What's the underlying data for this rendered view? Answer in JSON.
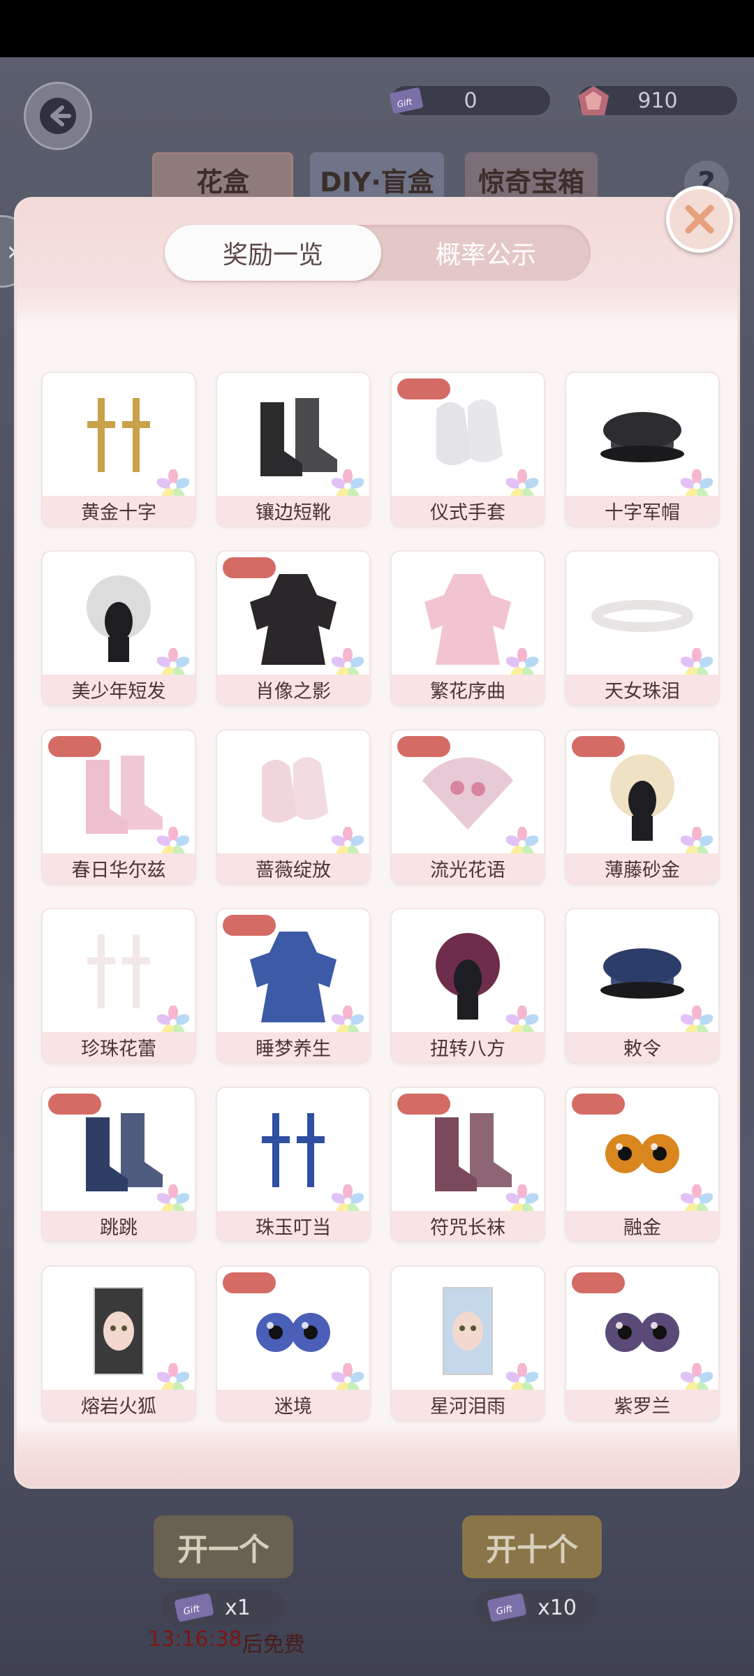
{
  "header": {
    "currency_ticket": {
      "value": "0",
      "icon": "ticket-icon"
    },
    "currency_gem": {
      "value": "910",
      "icon": "gem-icon"
    },
    "tabs": [
      {
        "label": "花盒"
      },
      {
        "label": "DIY·盲盒"
      },
      {
        "label": "惊奇宝箱"
      }
    ],
    "help_label": "?"
  },
  "modal": {
    "segments": {
      "active": "奖励一览",
      "inactive": "概率公示"
    },
    "items": [
      {
        "label": "黄金十字",
        "badge": false,
        "art": "gold-cross-earrings",
        "color": "#c9a14a"
      },
      {
        "label": "镶边短靴",
        "badge": false,
        "art": "black-boots",
        "color": "#2b2b2e"
      },
      {
        "label": "仪式手套",
        "badge": true,
        "art": "white-gloves",
        "color": "#e3e3e8"
      },
      {
        "label": "十字军帽",
        "badge": false,
        "art": "military-cap",
        "color": "#2d2d31"
      },
      {
        "label": "美少年短发",
        "badge": false,
        "art": "white-short-hair",
        "color": "#dcdcdc"
      },
      {
        "label": "肖像之影",
        "badge": true,
        "art": "dark-coat-outfit",
        "color": "#2b2629"
      },
      {
        "label": "繁花序曲",
        "badge": false,
        "art": "pink-dress",
        "color": "#f1c4cf"
      },
      {
        "label": "天女珠泪",
        "badge": false,
        "art": "pearl-headband",
        "color": "#e8e4e4"
      },
      {
        "label": "春日华尔兹",
        "badge": true,
        "art": "pink-shoes",
        "color": "#eebfcf"
      },
      {
        "label": "蔷薇绽放",
        "badge": false,
        "art": "lace-gloves",
        "color": "#f0d6da"
      },
      {
        "label": "流光花语",
        "badge": true,
        "art": "lace-fan",
        "color": "#e8cad6"
      },
      {
        "label": "薄藤砂金",
        "badge": true,
        "art": "blonde-curly-hair",
        "color": "#efe2c4"
      },
      {
        "label": "珍珠花蕾",
        "badge": false,
        "art": "pearl-tassel-earrings",
        "color": "#f2e8e8"
      },
      {
        "label": "睡梦养生",
        "badge": true,
        "art": "blue-robe",
        "color": "#3d5aa6"
      },
      {
        "label": "扭转八方",
        "badge": false,
        "art": "red-braided-hair",
        "color": "#6e2d4a"
      },
      {
        "label": "敕令",
        "badge": false,
        "art": "navy-hat-talisman",
        "color": "#2d3d6a"
      },
      {
        "label": "跳跳",
        "badge": true,
        "art": "blue-boots",
        "color": "#2f3e67"
      },
      {
        "label": "珠玉叮当",
        "badge": false,
        "art": "lantern-earrings",
        "color": "#2f4fa0"
      },
      {
        "label": "符咒长袜",
        "badge": true,
        "art": "purple-stockings",
        "color": "#7a4a5c"
      },
      {
        "label": "融金",
        "badge": true,
        "art": "golden-eyes",
        "color": "#d9861f"
      },
      {
        "label": "熔岩火狐",
        "badge": false,
        "art": "face-card-sweet",
        "color": "#3a3a3a"
      },
      {
        "label": "迷境",
        "badge": true,
        "art": "blue-eyes",
        "color": "#4a5fb8"
      },
      {
        "label": "星河泪雨",
        "badge": false,
        "art": "face-card-fantasy",
        "color": "#c5d7ea"
      },
      {
        "label": "紫罗兰",
        "badge": true,
        "art": "violet-eyes",
        "color": "#5a4a78"
      }
    ]
  },
  "bottom": {
    "open_one": "开一个",
    "open_ten": "开十个",
    "ticket_one": "x1",
    "ticket_ten": "x10",
    "free_time": "13:16:38",
    "free_suffix": "后免费"
  },
  "colors": {
    "badge": "#d46b65",
    "label_bg": "#f8e4e4",
    "modal_bg": "#faf5f4"
  }
}
